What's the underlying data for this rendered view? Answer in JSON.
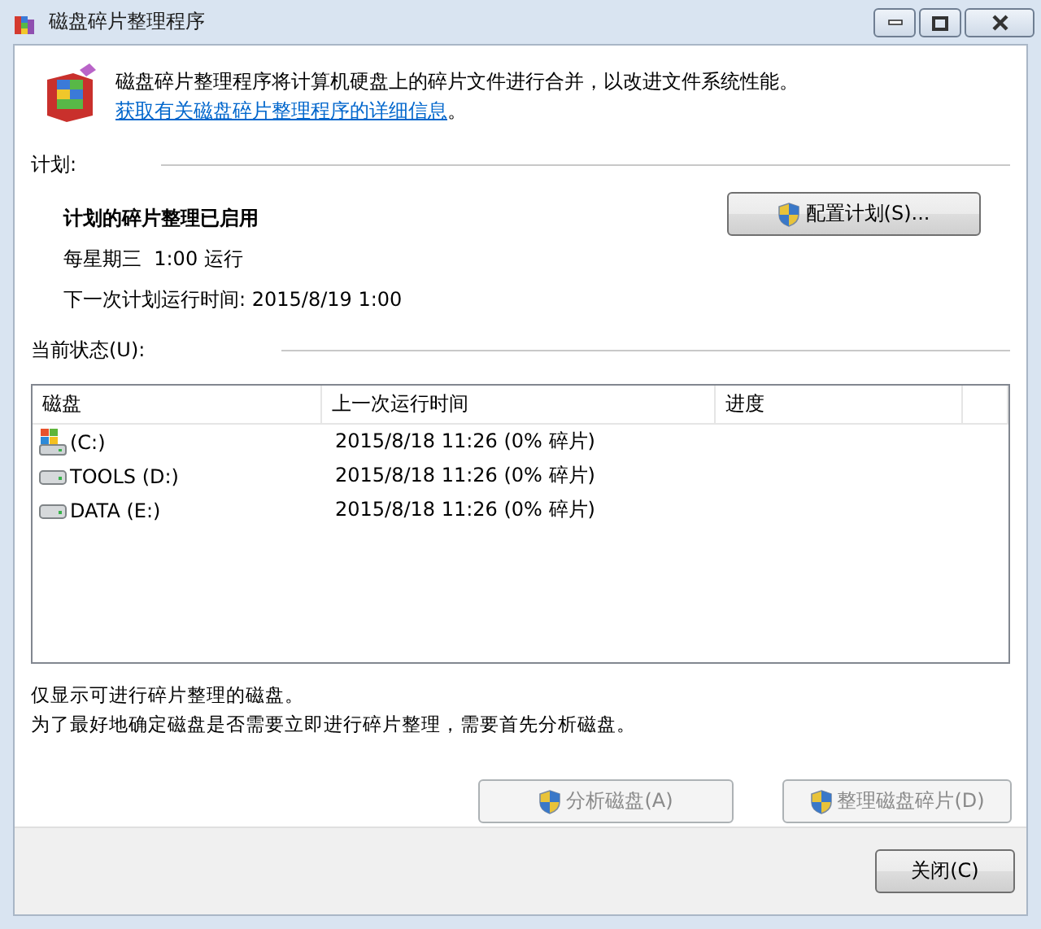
{
  "window": {
    "title": "磁盘碎片整理程序"
  },
  "intro": {
    "text": "磁盘碎片整理程序将计算机硬盘上的碎片文件进行合并，以改进文件系统性能。",
    "link": "获取有关磁盘碎片整理程序的详细信息",
    "end": "。"
  },
  "schedule": {
    "heading": "计划:",
    "status": "计划的碎片整理已启用",
    "frequency": "每星期三  1:00 运行",
    "next_run": "下一次计划运行时间: 2015/8/19 1:00",
    "button": {
      "label": "配置计划(S)...",
      "disabled": false
    }
  },
  "current_status": {
    "heading": "当前状态(U):",
    "columns": [
      "磁盘",
      "上一次运行时间",
      "进度"
    ],
    "rows": [
      {
        "kind": "system",
        "disk": "(C:)",
        "last_run": "2015/8/18 11:26 (0% 碎片)",
        "selected": false
      },
      {
        "kind": "drive",
        "disk": "TOOLS (D:)",
        "last_run": "2015/8/18 11:26 (0% 碎片)",
        "selected": false
      },
      {
        "kind": "drive",
        "disk": "DATA (E:)",
        "last_run": "2015/8/18 11:26 (0% 碎片)",
        "selected": false
      }
    ]
  },
  "notes": [
    "仅显示可进行碎片整理的磁盘。",
    "为了最好地确定磁盘是否需要立即进行碎片整理，需要首先分析磁盘。"
  ],
  "actions": [
    {
      "label": "分析磁盘(A)",
      "disabled": true
    },
    {
      "label": "整理磁盘碎片(D)",
      "disabled": true
    }
  ],
  "footer": {
    "close": "关闭(C)"
  }
}
